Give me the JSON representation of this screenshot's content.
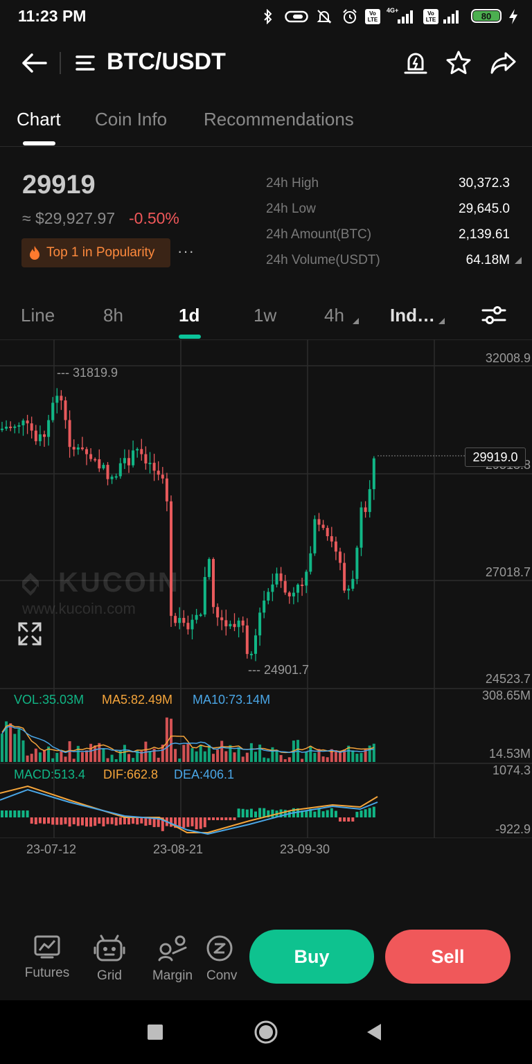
{
  "status_bar": {
    "time": "11:23 PM",
    "network_label": "4G+",
    "volte_1": "Vo LTE",
    "volte_2": "Vo LTE",
    "battery": "80",
    "icons": [
      "bluetooth-icon",
      "vibrate-icon",
      "dnd-off-icon",
      "alarm-icon",
      "volte-icon",
      "signal-icon",
      "volte-icon",
      "signal-icon",
      "battery-icon",
      "charging-icon"
    ]
  },
  "header": {
    "title": "BTC/USDT",
    "icons": [
      "back-arrow-icon",
      "menu-icon",
      "price-alert-icon",
      "star-icon",
      "share-icon"
    ]
  },
  "tabs": [
    {
      "label": "Chart",
      "active": true
    },
    {
      "label": "Coin Info",
      "active": false
    },
    {
      "label": "Recommendations",
      "active": false
    }
  ],
  "price": {
    "last": "29919",
    "usd": "≈ $29,927.97",
    "change": "-0.50%",
    "change_color": "#f0585a",
    "badge": "Top 1 in Popularity",
    "more": "···"
  },
  "stats": [
    {
      "label": "24h High",
      "value": "30,372.3"
    },
    {
      "label": "24h Low",
      "value": "29,645.0"
    },
    {
      "label": "24h Amount(BTC)",
      "value": "2,139.61"
    },
    {
      "label": "24h Volume(USDT)",
      "value": "64.18M"
    }
  ],
  "periods": [
    {
      "label": "Line",
      "active": false
    },
    {
      "label": "8h",
      "active": false
    },
    {
      "label": "1d",
      "active": true
    },
    {
      "label": "1w",
      "active": false
    },
    {
      "label": "4h",
      "active": false,
      "dropdown": true
    },
    {
      "label": "Ind…",
      "active": false,
      "dropdown": true
    }
  ],
  "chart": {
    "watermark_brand": "KUCOIN",
    "watermark_url": "www.kucoin.com",
    "y_axis": [
      "32008.9",
      "29513.8",
      "27018.7",
      "24523.7"
    ],
    "current_price_tag": "29919.0",
    "high_marker": "--- 31819.9",
    "low_marker": "--- 24901.7",
    "vol_labels": {
      "vol": "VOL:35.03M",
      "ma5": "MA5:82.49M",
      "ma10": "MA10:73.14M"
    },
    "vol_axis": [
      "308.65M",
      "14.53M"
    ],
    "macd_labels": {
      "macd": "MACD:513.4",
      "dif": "DIF:662.8",
      "dea": "DEA:406.1"
    },
    "macd_axis": [
      "1074.3",
      "-922.9"
    ],
    "x_axis": [
      "23-07-12",
      "23-08-21",
      "23-09-30"
    ],
    "colors": {
      "up": "#11b686",
      "down": "#e85a5c",
      "ma5": "#f5a53b",
      "ma10": "#4aa6e6",
      "dif": "#f5a53b",
      "dea": "#4aa6e6"
    }
  },
  "chart_data": {
    "type": "candlestick",
    "note_x": "daily candles",
    "y_range": [
      24523.7,
      32008.9
    ],
    "highest": 31819.9,
    "lowest": 24901.7,
    "last": 29919.0
  },
  "bottom": {
    "items": [
      {
        "label": "Futures",
        "icon": "futures-icon"
      },
      {
        "label": "Grid",
        "icon": "grid-bot-icon"
      },
      {
        "label": "Margin",
        "icon": "margin-icon"
      },
      {
        "label": "Conv",
        "icon": "convert-icon"
      }
    ],
    "buy": "Buy",
    "sell": "Sell"
  }
}
